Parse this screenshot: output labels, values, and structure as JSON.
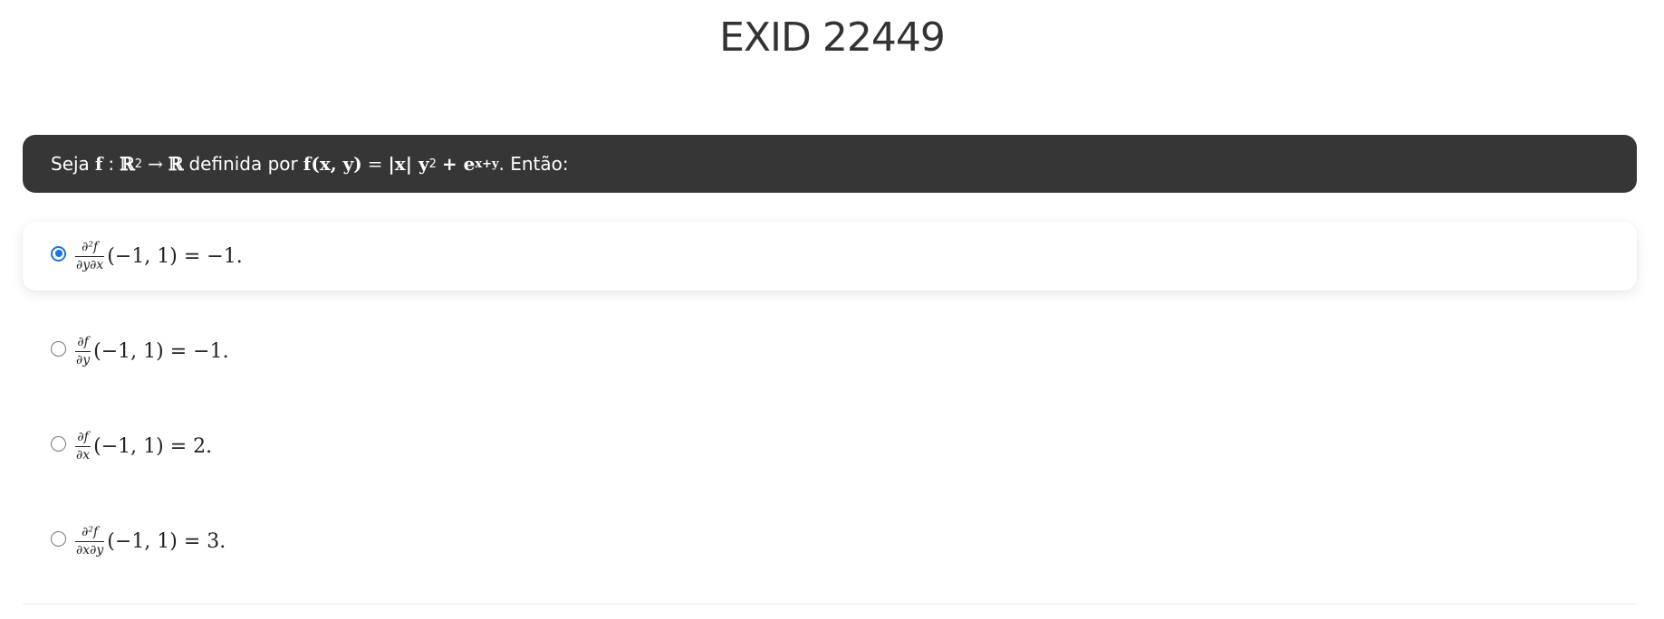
{
  "title": "EXID 22449",
  "question": {
    "prefix": "Seja",
    "func": "f",
    "colon": ":",
    "domain": "ℝ",
    "domain_exp": "2",
    "arrow": "→",
    "codomain": "ℝ",
    "mid": "definida por",
    "lhs": "f(x, y)",
    "eq": "=",
    "rhs": "|x| y",
    "rhs_exp": "2",
    "plus": "+ e",
    "e_exp": "x+y",
    "suffix": ". Então:"
  },
  "options": [
    {
      "num": "∂²f",
      "den": "∂y∂x",
      "rest": "(−1, 1) = −1.",
      "selected": true
    },
    {
      "num": "∂f",
      "den": "∂y",
      "rest": "(−1, 1) = −1.",
      "selected": false
    },
    {
      "num": "∂f",
      "den": "∂x",
      "rest": "(−1, 1) = 2.",
      "selected": false
    },
    {
      "num": "∂²f",
      "den": "∂x∂y",
      "rest": "(−1, 1) = 3.",
      "selected": false
    }
  ],
  "colors": {
    "accent": "#1a73e8",
    "question_bg": "#363636"
  }
}
